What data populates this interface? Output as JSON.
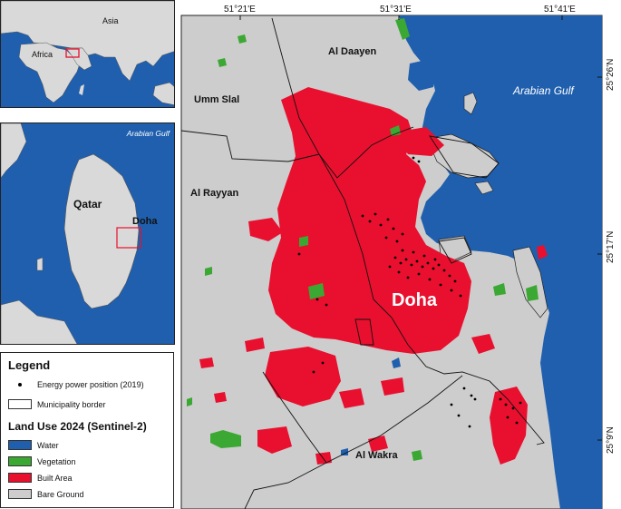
{
  "colors": {
    "water": "#1f5fae",
    "vegetation": "#3aa832",
    "built": "#e8102e",
    "bare": "#cdcdcd",
    "land_inset": "#d9d9d9"
  },
  "world_inset": {
    "labels": {
      "asia": "Asia",
      "africa": "Africa"
    }
  },
  "qatar_inset": {
    "labels": {
      "gulf": "Arabian Gulf",
      "qatar": "Qatar",
      "doha": "Doha"
    }
  },
  "main_map": {
    "lon_ticks": [
      "51°21'E",
      "51°31'E",
      "51°41'E"
    ],
    "lat_ticks": [
      "25°26'N",
      "25°17'N",
      "25°9'N"
    ],
    "gulf_label": "Arabian Gulf",
    "city_label": "Doha",
    "municipalities": {
      "al_daayen": "Al Daayen",
      "umm_slal": "Umm Slal",
      "al_rayyan": "Al Rayyan",
      "al_wakra": "Al Wakra"
    }
  },
  "legend": {
    "title": "Legend",
    "energy": "Energy power position (2019)",
    "border": "Municipality border",
    "landuse_title": "Land Use 2024 (Sentinel-2)",
    "classes": {
      "water": "Water",
      "vegetation": "Vegetation",
      "built": "Built Area",
      "bare": "Bare Ground"
    }
  }
}
